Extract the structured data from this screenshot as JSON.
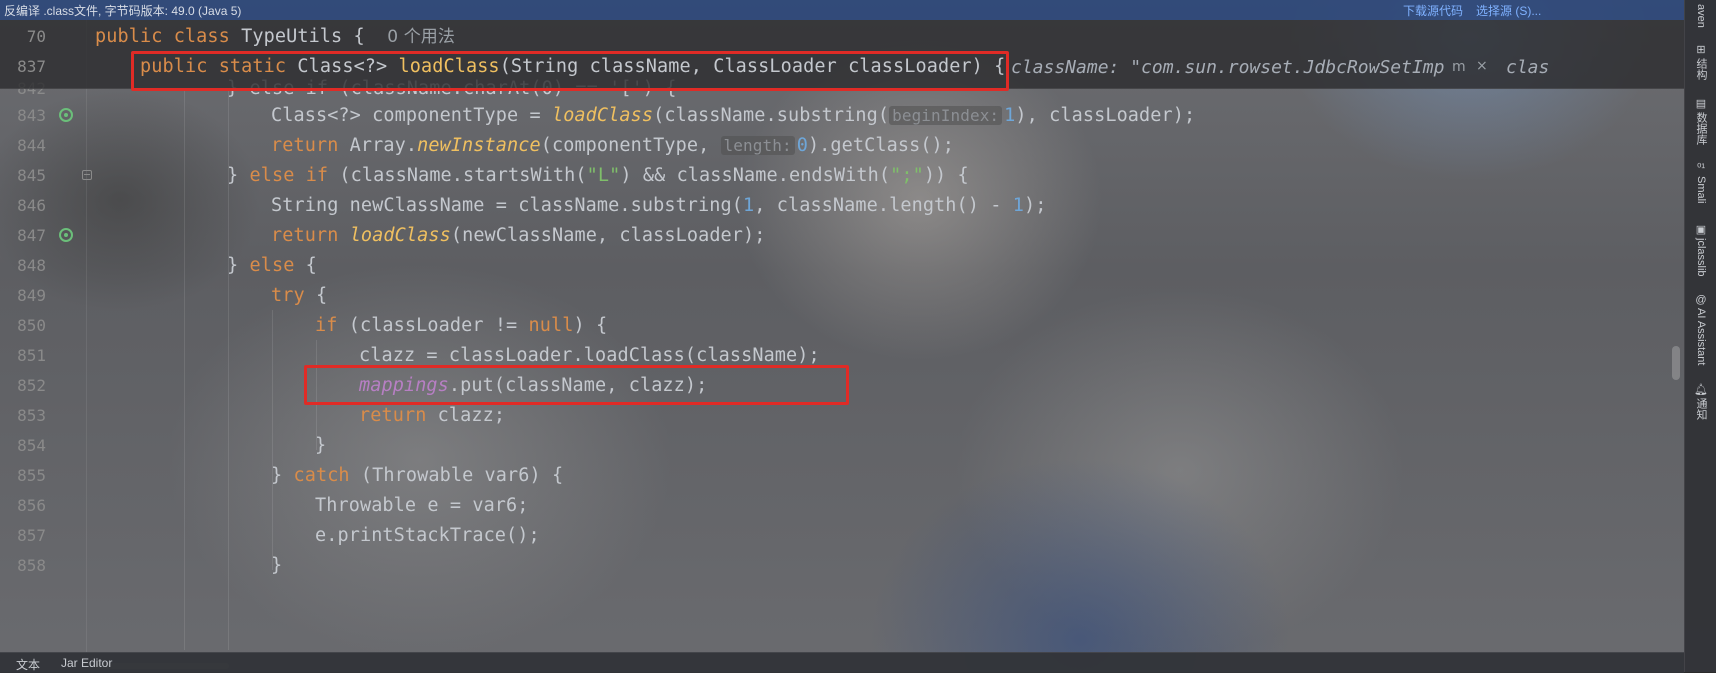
{
  "infobar": {
    "message": "反编译 .class文件, 字节码版本: 49.0 (Java 5)",
    "download_source": "下载源代码",
    "choose_source": "选择源 (S)..."
  },
  "sticky": {
    "line70": {
      "number": "70",
      "kw1": "public",
      "kw2": "class",
      "name": "TypeUtils",
      "brace": "{",
      "usages": "0 个用法"
    },
    "line837": {
      "number": "837",
      "kw1": "public",
      "kw2": "static",
      "ret": "Class<?>",
      "fn": "loadClass",
      "params": "(String className, ClassLoader classLoader) {",
      "inlay": "className: \"com.sun.rowset.JdbcRowSetImp",
      "inlay_tail": "clas",
      "popup_icon": "m",
      "popup_close": "×"
    }
  },
  "lines": {
    "l842": {
      "number": "842",
      "text": "} else if (className.charAt(0) == '[') {"
    },
    "l843": {
      "number": "843",
      "a": "Class<?> componentType = ",
      "fn": "loadClass",
      "b": "(className.substring(",
      "hint": "beginIndex:",
      "num": "1",
      "c": "), classLoader);"
    },
    "l844": {
      "number": "844",
      "kw": "return",
      "a": " Array.",
      "fn": "newInstance",
      "b": "(componentType, ",
      "hint": "length:",
      "num": "0",
      "c": ").getClass();"
    },
    "l845": {
      "number": "845",
      "a": "} ",
      "kw1": "else",
      "kw2": "if",
      "b": " (className.startsWith(",
      "s1": "\"L\"",
      "c": ") && className.endsWith(",
      "s2": "\";\"",
      "d": ")) {"
    },
    "l846": {
      "number": "846",
      "a": "String newClassName = className.substring(",
      "n1": "1",
      "b": ", className.length() - ",
      "n2": "1",
      "c": ");"
    },
    "l847": {
      "number": "847",
      "kw": "return",
      "fn": "loadClass",
      "a": "(newClassName, classLoader);"
    },
    "l848": {
      "number": "848",
      "a": "} ",
      "kw": "else",
      "b": " {"
    },
    "l849": {
      "number": "849",
      "kw": "try",
      "a": " {"
    },
    "l850": {
      "number": "850",
      "kw": "if",
      "a": " (classLoader != ",
      "kw2": "null",
      "b": ") {"
    },
    "l851": {
      "number": "851",
      "a": "clazz = classLoader.loadClass(className);"
    },
    "l852": {
      "number": "852",
      "field": "mappings",
      "a": ".put(className, clazz);"
    },
    "l853": {
      "number": "853",
      "kw": "return",
      "a": " clazz;"
    },
    "l854": {
      "number": "854",
      "a": "}"
    },
    "l855": {
      "number": "855",
      "a": "} ",
      "kw": "catch",
      "b": " (Throwable var6) {"
    },
    "l856": {
      "number": "856",
      "a": "Throwable e = var6;"
    },
    "l857": {
      "number": "857",
      "a": "e.printStackTrace();"
    },
    "l858": {
      "number": "858",
      "a": "}"
    }
  },
  "rightbar": {
    "maven": "aven",
    "structure": "结构",
    "database": "数据库",
    "smali": "Smali",
    "jclasslib": "jclasslib",
    "ai": "AI Assistant",
    "notifications": "通知"
  },
  "bottombar": {
    "tab_text": "文本",
    "tab_jar": "Jar Editor"
  },
  "colors": {
    "keyword": "#d98c4a",
    "function": "#f0c060",
    "string": "#7fbf6a",
    "number": "#6ea6d8",
    "field": "#b77fc4",
    "highlight_box": "#e02b26"
  }
}
